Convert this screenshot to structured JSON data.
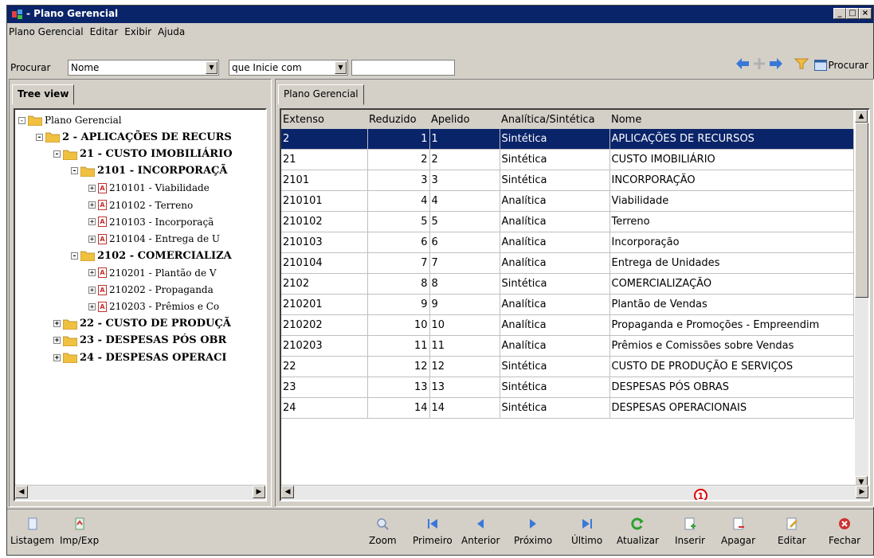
{
  "window": {
    "title": "- Plano Gerencial"
  },
  "menu": [
    "Plano Gerencial",
    "Editar",
    "Exibir",
    "Ajuda"
  ],
  "toolbar": {
    "search_label": "Procurar",
    "field_value": "Nome",
    "condition_value": "que Inicie com",
    "search_text": "",
    "procurar_button": "Procurar"
  },
  "left_tab": "Tree view",
  "right_tab": "Plano Gerencial",
  "tree": [
    {
      "text": "Plano Gerencial",
      "level": 0,
      "pm": "-",
      "kind": "folder",
      "bold": false
    },
    {
      "text": "2 - APLICAÇÕES DE RECURS",
      "level": 1,
      "pm": "-",
      "kind": "folder",
      "bold": true
    },
    {
      "text": "21 - CUSTO IMOBILIÁRIO",
      "level": 2,
      "pm": "-",
      "kind": "folder",
      "bold": true
    },
    {
      "text": "2101 - INCORPORAÇÃ",
      "level": 3,
      "pm": "-",
      "kind": "folder",
      "bold": true
    },
    {
      "text": "210101 - Viabilidade",
      "level": 4,
      "pm": "+",
      "kind": "doc",
      "bold": false
    },
    {
      "text": "210102 - Terreno",
      "level": 4,
      "pm": "+",
      "kind": "doc",
      "bold": false
    },
    {
      "text": "210103 - Incorporaçã",
      "level": 4,
      "pm": "+",
      "kind": "doc",
      "bold": false
    },
    {
      "text": "210104 - Entrega de U",
      "level": 4,
      "pm": "+",
      "kind": "doc",
      "bold": false
    },
    {
      "text": "2102 - COMERCIALIZA",
      "level": 3,
      "pm": "-",
      "kind": "folder",
      "bold": true
    },
    {
      "text": "210201 - Plantão de V",
      "level": 4,
      "pm": "+",
      "kind": "doc",
      "bold": false
    },
    {
      "text": "210202 - Propaganda",
      "level": 4,
      "pm": "+",
      "kind": "doc",
      "bold": false
    },
    {
      "text": "210203 - Prêmios e Co",
      "level": 4,
      "pm": "+",
      "kind": "doc",
      "bold": false
    },
    {
      "text": "22 - CUSTO DE PRODUÇÃ",
      "level": 2,
      "pm": "+",
      "kind": "folder",
      "bold": true
    },
    {
      "text": "23 - DESPESAS PÓS OBR",
      "level": 2,
      "pm": "+",
      "kind": "folder",
      "bold": true
    },
    {
      "text": "24 - DESPESAS OPERACI",
      "level": 2,
      "pm": "+",
      "kind": "folder",
      "bold": true
    }
  ],
  "grid": {
    "columns": [
      "Extenso",
      "Reduzido",
      "Apelido",
      "Analítica/Sintética",
      "Nome"
    ],
    "rows": [
      [
        "2",
        "1",
        "1",
        "Sintética",
        "APLICAÇÕES DE RECURSOS"
      ],
      [
        "21",
        "2",
        "2",
        "Sintética",
        "CUSTO IMOBILIÁRIO"
      ],
      [
        "2101",
        "3",
        "3",
        "Sintética",
        "INCORPORAÇÃO"
      ],
      [
        "210101",
        "4",
        "4",
        "Analítica",
        "Viabilidade"
      ],
      [
        "210102",
        "5",
        "5",
        "Analítica",
        "Terreno"
      ],
      [
        "210103",
        "6",
        "6",
        "Analítica",
        "Incorporação"
      ],
      [
        "210104",
        "7",
        "7",
        "Analítica",
        "Entrega de Unidades"
      ],
      [
        "2102",
        "8",
        "8",
        "Sintética",
        "COMERCIALIZAÇÃO"
      ],
      [
        "210201",
        "9",
        "9",
        "Analítica",
        "Plantão de Vendas"
      ],
      [
        "210202",
        "10",
        "10",
        "Analítica",
        "Propaganda e Promoções - Empreendim"
      ],
      [
        "210203",
        "11",
        "11",
        "Analítica",
        "Prêmios e Comissões sobre Vendas"
      ],
      [
        "22",
        "12",
        "12",
        "Sintética",
        "CUSTO DE PRODUÇÃO E SERVIÇOS"
      ],
      [
        "23",
        "13",
        "13",
        "Sintética",
        "DESPESAS PÓS OBRAS"
      ],
      [
        "24",
        "14",
        "14",
        "Sintética",
        "DESPESAS OPERACIONAIS"
      ]
    ],
    "selected_row": 0
  },
  "badge": "1",
  "bottom_left": [
    {
      "label": "Listagem",
      "icon": "report-icon"
    },
    {
      "label": "Imp/Exp",
      "icon": "import-export-icon"
    }
  ],
  "bottom_right": [
    {
      "label": "Zoom",
      "icon": "zoom-icon"
    },
    {
      "label": "Primeiro",
      "icon": "first-record-icon"
    },
    {
      "label": "Anterior",
      "icon": "previous-record-icon"
    },
    {
      "label": "Próximo",
      "icon": "next-record-icon"
    },
    {
      "label": "Último",
      "icon": "last-record-icon"
    },
    {
      "label": "Atualizar",
      "icon": "refresh-icon"
    },
    {
      "label": "Inserir",
      "icon": "insert-icon"
    },
    {
      "label": "Apagar",
      "icon": "delete-icon"
    },
    {
      "label": "Editar",
      "icon": "edit-icon"
    },
    {
      "label": "Fechar",
      "icon": "close-icon"
    }
  ],
  "colors": {
    "titlebar": "#0a246a",
    "selection": "#0a246a",
    "folder": "#f0c040",
    "arrow_blue": "#3a78d8",
    "badge_red": "#e00000"
  }
}
